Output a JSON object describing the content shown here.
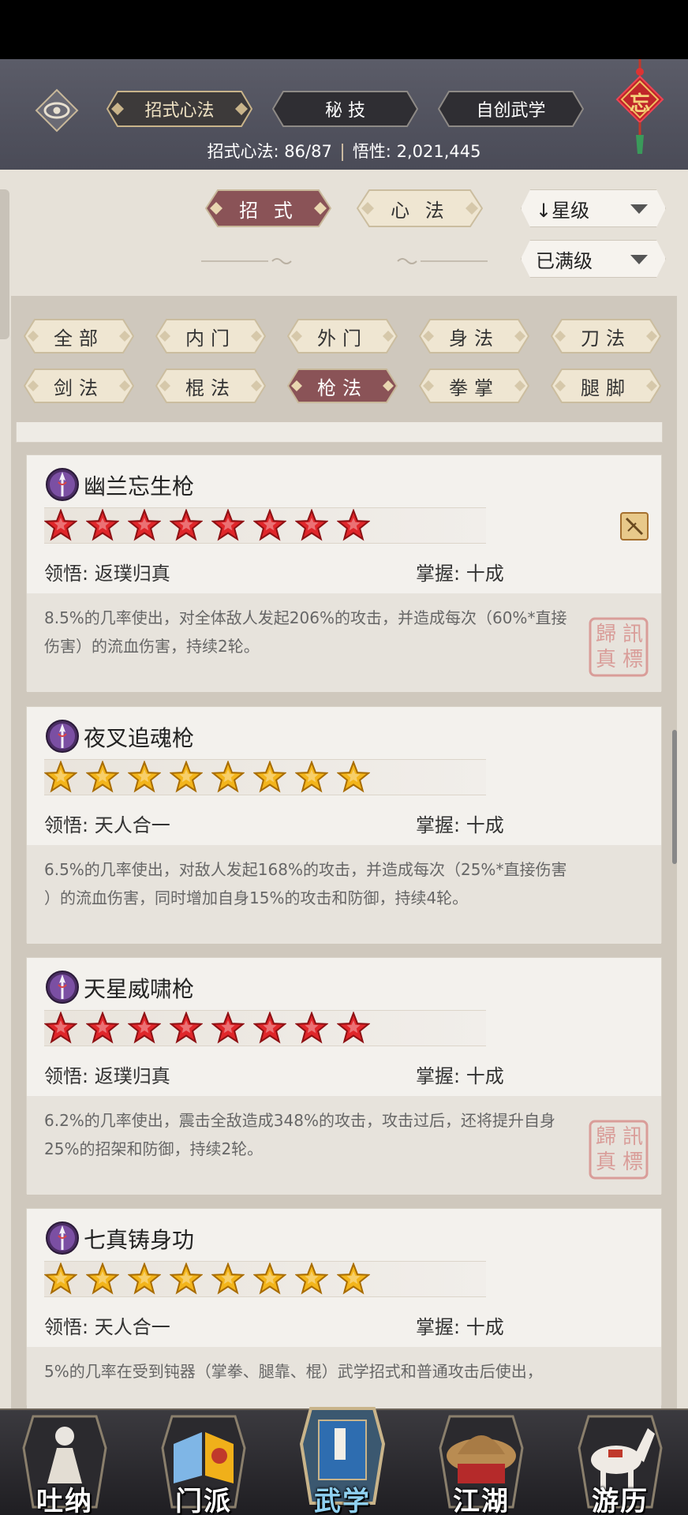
{
  "header": {
    "tabs": [
      "招式心法",
      "秘 技",
      "自创武学"
    ],
    "knot_char": "忘",
    "stats_left_label": "招式心法: ",
    "stats_left_value": "86/87",
    "stats_right_label": "悟性: ",
    "stats_right_value": "2,021,445"
  },
  "mode_tabs": [
    "招 式",
    "心 法"
  ],
  "dropdowns": {
    "sort": "↓星级",
    "filter": "已满级"
  },
  "categories": [
    "全部",
    "内门",
    "外门",
    "身法",
    "刀法",
    "剑法",
    "棍法",
    "枪法",
    "拳掌",
    "腿脚"
  ],
  "selected_category": "枪法",
  "skills": [
    {
      "name": "幽兰忘生枪",
      "star_color": "red",
      "stars": 8,
      "comprehension_label": "领悟: ",
      "comprehension": "返璞归真",
      "mastery_label": "掌握: ",
      "mastery": "十成",
      "desc_line1": "8.5%的几率使出，对全体敌人发起206%的攻击，并造成每次（60%*直接",
      "desc_line2": "伤害）的流血伤害，持续2轮。",
      "seal": true,
      "badge": true
    },
    {
      "name": "夜叉追魂枪",
      "star_color": "gold",
      "stars": 8,
      "comprehension_label": "领悟: ",
      "comprehension": "天人合一",
      "mastery_label": "掌握: ",
      "mastery": "十成",
      "desc_line1": "6.5%的几率使出，对敌人发起168%的攻击，并造成每次（25%*直接伤害",
      "desc_line2": "）的流血伤害，同时增加自身15%的攻击和防御，持续4轮。",
      "seal": false,
      "badge": false
    },
    {
      "name": "天星威啸枪",
      "star_color": "red",
      "stars": 8,
      "comprehension_label": "领悟: ",
      "comprehension": "返璞归真",
      "mastery_label": "掌握: ",
      "mastery": "十成",
      "desc_line1": "6.2%的几率使出，震击全敌造成348%的攻击，攻击过后，还将提升自身",
      "desc_line2": "25%的招架和防御，持续2轮。",
      "seal": true,
      "badge": false
    },
    {
      "name": "七真铸身功",
      "star_color": "gold",
      "stars": 8,
      "comprehension_label": "领悟: ",
      "comprehension": "天人合一",
      "mastery_label": "掌握: ",
      "mastery": "十成",
      "desc_line1": "5%的几率在受到钝器（掌拳、腿靠、棍）武学招式和普通攻击后使出，",
      "desc_line2": "",
      "seal": false,
      "badge": false
    }
  ],
  "seal_text": "訊標歸真",
  "bottom_nav": [
    "吐纳",
    "门派",
    "武学",
    "江湖",
    "游历"
  ],
  "active_nav": "武学",
  "colors": {
    "header_bg": "#50515d",
    "accent_red": "#8a4a4f",
    "page_bg": "#e6e1d8",
    "star_red": "#e0262a",
    "star_gold": "#f3b51b"
  }
}
